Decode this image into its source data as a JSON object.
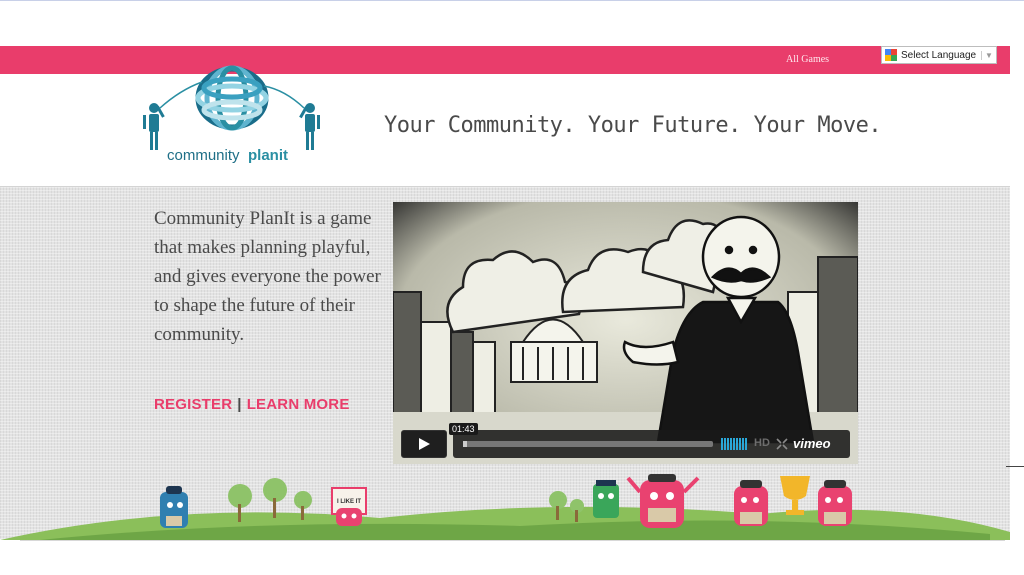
{
  "topbar": {
    "nav_link": "All Games",
    "language_select": "Select Language"
  },
  "header": {
    "logo_text_a": "community",
    "logo_text_b": "planit",
    "tagline": "Your Community. Your Future. Your Move."
  },
  "hero": {
    "description": "Community PlanIt is a game that makes planning playful, and gives everyone the power to shape the future of their community.",
    "register_label": "REGISTER",
    "separator": "|",
    "learn_more_label": "LEARN MORE"
  },
  "video": {
    "timestamp": "01:43",
    "hd_label": "HD",
    "brand": "vimeo"
  },
  "illustration": {
    "sign_text": "I LIKE IT"
  },
  "colors": {
    "brand_pink": "#e93d6b",
    "logo_teal": "#2a8fa3",
    "text_gray": "#4a4a4a"
  }
}
